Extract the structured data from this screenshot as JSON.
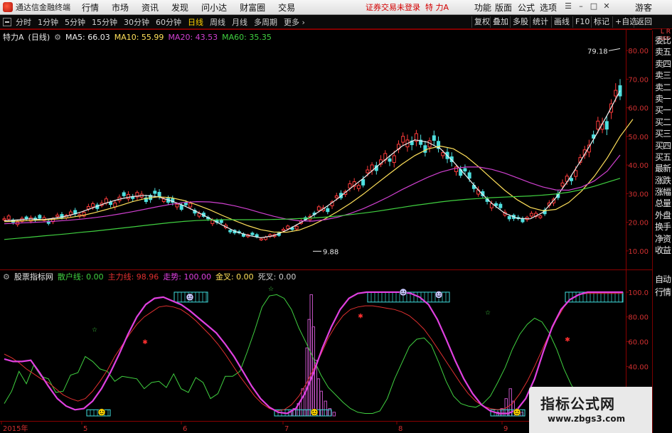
{
  "menubar": {
    "app_title": "通达信金融终端",
    "items": [
      "行情",
      "市场",
      "资讯",
      "发现",
      "问小达",
      "财富圈",
      "交易"
    ],
    "warning": "证券交易未登录",
    "stock_name": "特 力A",
    "right_items": [
      "功能",
      "版面",
      "公式",
      "选项"
    ],
    "guest": "游客"
  },
  "toolbar": {
    "periods": [
      "分时",
      "1分钟",
      "5分钟",
      "15分钟",
      "30分钟",
      "60分钟",
      "日线",
      "周线",
      "月线",
      "多周期",
      "更多"
    ],
    "active_period": "日线",
    "right_buttons": [
      "复权",
      "叠加",
      "多股",
      "统计",
      "画线",
      "F10",
      "标记",
      "+自选",
      "返回"
    ]
  },
  "main_chart": {
    "stock_label": "特力A",
    "period_label": "(日线)",
    "ma": [
      {
        "label": "MA5: 66.03",
        "color": "#f0f0f0"
      },
      {
        "label": "MA10: 55.99",
        "color": "#ffe05a"
      },
      {
        "label": "MA20: 43.53",
        "color": "#d040d0"
      },
      {
        "label": "MA60: 35.35",
        "color": "#40d040"
      }
    ],
    "price_ticks": [
      "80.00",
      "70.00",
      "60.00",
      "50.00",
      "40.00",
      "30.00",
      "20.00",
      "10.00"
    ],
    "high_label": "79.18",
    "low_label": "9.88"
  },
  "indicator": {
    "name": "股票指标网",
    "items": [
      {
        "label": "散户线: 0.00",
        "color": "#40d040"
      },
      {
        "label": "主力线: 98.96",
        "color": "#e03030"
      },
      {
        "label": "走势: 100.00",
        "color": "#e040e0"
      },
      {
        "label": "金叉: 0.00",
        "color": "#ffe05a"
      },
      {
        "label": "死叉: 0.00",
        "color": "#d0d0d0"
      }
    ],
    "ticks": [
      "100.0",
      "80.00",
      "60.00",
      "40.00",
      "20.00"
    ]
  },
  "date_axis": [
    "2015年",
    "5",
    "6",
    "7",
    "8",
    "9"
  ],
  "side_panel": {
    "corner": [
      "L",
      "R"
    ],
    "corner_sub": "2020",
    "buttons": [
      "委比",
      "卖五",
      "卖四",
      "卖三",
      "卖二",
      "卖一",
      "买一",
      "买二",
      "买三",
      "买四",
      "买五",
      "最新",
      "涨跌",
      "涨幅",
      "总量",
      "外盘",
      "换手",
      "净资",
      "收益"
    ],
    "bottom_buttons": [
      "自动",
      "行情"
    ]
  },
  "watermark": {
    "title": "指标公式网",
    "url": "www.zbgs3.com"
  },
  "chart_data": [
    {
      "type": "candlestick",
      "ylim": [
        5,
        84
      ],
      "series_ma": [
        {
          "name": "MA5",
          "values": [
            20.5,
            20.8,
            21.2,
            20.9,
            21.5,
            22.3,
            23.6,
            25.2,
            26.8,
            28.1,
            29.0,
            29.4,
            28.9,
            27.5,
            25.8,
            23.7,
            21.4,
            19.0,
            16.8,
            15.4,
            14.6,
            15.3,
            17.2,
            19.6,
            22.2,
            25.1,
            28.3,
            31.9,
            35.4,
            39.3,
            43.0,
            46.6,
            48.8,
            48.0,
            45.7,
            41.2,
            36.2,
            31.0,
            26.6,
            23.2,
            21.4,
            21.2,
            23.5,
            28.6,
            34.9,
            42.0,
            49.5,
            57.5,
            66.0
          ]
        },
        {
          "name": "MA10",
          "values": [
            20.2,
            20.4,
            20.6,
            20.8,
            21.1,
            21.6,
            22.3,
            23.3,
            24.5,
            25.8,
            27.2,
            28.3,
            28.9,
            28.6,
            27.6,
            26.1,
            24.4,
            22.4,
            20.5,
            18.8,
            17.4,
            16.6,
            16.5,
            17.3,
            19.0,
            21.2,
            23.8,
            26.7,
            29.9,
            33.4,
            36.9,
            40.3,
            43.3,
            45.6,
            46.6,
            45.7,
            43.0,
            39.3,
            35.2,
            31.2,
            27.8,
            25.2,
            24.0,
            24.5,
            26.9,
            30.9,
            36.1,
            42.5,
            50.0,
            56.0
          ]
        },
        {
          "name": "MA20",
          "values": [
            19.5,
            19.7,
            19.9,
            20.1,
            20.4,
            20.7,
            21.1,
            21.6,
            22.2,
            22.9,
            23.7,
            24.6,
            25.5,
            26.3,
            26.9,
            27.2,
            27.1,
            26.6,
            25.7,
            24.6,
            23.3,
            22.1,
            21.1,
            20.5,
            20.4,
            20.9,
            21.8,
            23.1,
            24.8,
            26.8,
            29.0,
            31.4,
            33.6,
            35.7,
            37.5,
            38.7,
            39.3,
            39.3,
            38.5,
            37.2,
            35.5,
            33.8,
            32.3,
            31.3,
            31.2,
            32.3,
            34.5,
            37.9,
            43.5
          ]
        },
        {
          "name": "MA60",
          "values": [
            14.0,
            14.4,
            14.8,
            15.2,
            15.6,
            16.0,
            16.5,
            16.9,
            17.4,
            17.9,
            18.4,
            18.9,
            19.4,
            19.9,
            20.3,
            20.6,
            20.8,
            20.9,
            20.9,
            20.9,
            20.9,
            21.0,
            21.1,
            21.3,
            21.5,
            21.8,
            22.2,
            22.7,
            23.2,
            23.8,
            24.5,
            25.2,
            25.9,
            26.5,
            27.1,
            27.6,
            28.0,
            28.3,
            28.6,
            28.8,
            29.0,
            29.2,
            29.5,
            29.9,
            30.5,
            31.4,
            32.6,
            34.0,
            35.35
          ]
        }
      ],
      "high": 79.18,
      "low": 9.88
    },
    {
      "type": "line",
      "ylim": [
        0,
        108
      ],
      "series": [
        {
          "name": "散户线",
          "values": [
            10,
            20,
            36,
            26,
            41,
            32,
            30,
            19,
            20,
            33,
            35,
            48,
            44,
            38,
            36,
            28,
            32,
            31,
            30,
            22,
            27,
            28,
            23,
            34,
            22,
            19,
            31,
            27,
            14,
            18,
            32,
            32,
            36,
            52,
            69,
            88,
            97,
            98,
            95,
            86,
            71,
            59,
            46,
            33,
            23,
            17,
            11,
            6,
            3,
            2,
            2,
            4,
            14,
            30,
            43,
            56,
            62,
            63,
            57,
            43,
            28,
            16,
            10,
            8,
            7,
            10,
            16,
            27,
            39,
            54,
            66,
            74,
            79,
            76,
            67,
            54,
            38,
            25,
            16,
            10,
            6,
            4,
            2,
            1,
            0
          ]
        },
        {
          "name": "主力线",
          "values": [
            50,
            47,
            43,
            38,
            34,
            30,
            27,
            22,
            17,
            14,
            12,
            14,
            20,
            28,
            37,
            48,
            57,
            66,
            74,
            80,
            84,
            88,
            89,
            88,
            86,
            82,
            77,
            71,
            65,
            58,
            50,
            41,
            32,
            24,
            16,
            10,
            6,
            4,
            5,
            9,
            16,
            26,
            38,
            50,
            63,
            73,
            81,
            86,
            88,
            89,
            89,
            88,
            87,
            86,
            84,
            81,
            76,
            70,
            62,
            53,
            44,
            35,
            26,
            18,
            12,
            8,
            6,
            5,
            6,
            10,
            18,
            28,
            40,
            53,
            66,
            78,
            88,
            95,
            98,
            99,
            99,
            99,
            99,
            99,
            98.96
          ]
        },
        {
          "name": "走势",
          "values": [
            46,
            44,
            44,
            45,
            35,
            24,
            14,
            8,
            5,
            6,
            12,
            22,
            35,
            50,
            66,
            80,
            90,
            95,
            96,
            93,
            90,
            85,
            79,
            73,
            67,
            58,
            48,
            36,
            24,
            14,
            7,
            3,
            2,
            6,
            18,
            35,
            55,
            72,
            86,
            95,
            99,
            100,
            100,
            100,
            100,
            100,
            99,
            96,
            90,
            78,
            62,
            45,
            30,
            18,
            9,
            4,
            2,
            2,
            5,
            14,
            30,
            52,
            72,
            86,
            94,
            98,
            100,
            100,
            100,
            100,
            100
          ]
        }
      ]
    }
  ]
}
